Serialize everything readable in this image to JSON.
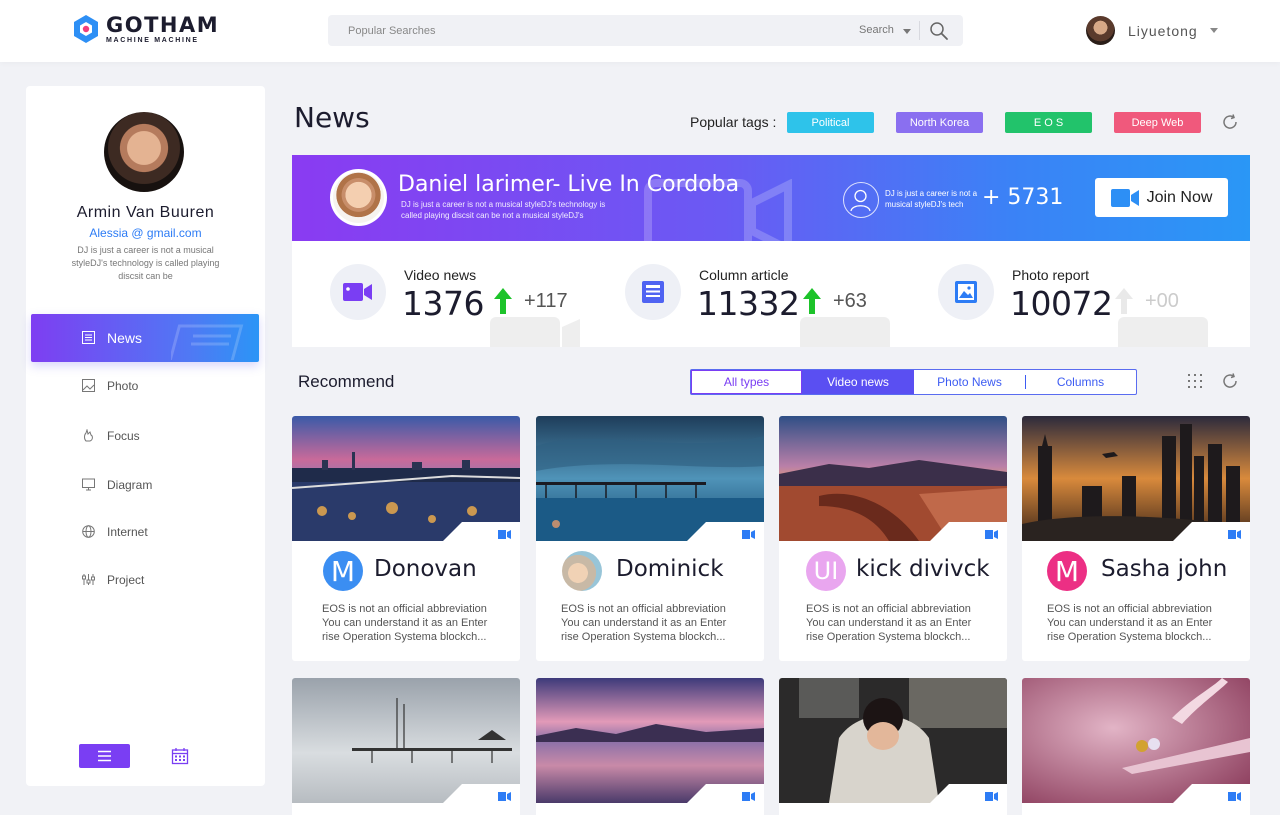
{
  "app": {
    "logo_title": "GOTHAM",
    "logo_sub": "MACHINE MACHINE",
    "brand_color": "#2d8ff5"
  },
  "search": {
    "placeholder": "Popular Searches",
    "scope": "Search"
  },
  "user": {
    "name": "Liyuetong"
  },
  "sidebar": {
    "profile_name": "Armin Van Buuren",
    "profile_email": "Alessia @ gmail.com",
    "profile_desc": "DJ is just a career is not a musical styleDJ's technology is called playing discsit can be",
    "items": [
      {
        "label": "News",
        "icon": "news-icon",
        "active": true
      },
      {
        "label": "Photo",
        "icon": "photo-icon"
      },
      {
        "label": "Focus",
        "icon": "focus-icon"
      },
      {
        "label": "Diagram",
        "icon": "diagram-icon"
      },
      {
        "label": "Internet",
        "icon": "globe-icon"
      },
      {
        "label": "Project",
        "icon": "project-icon"
      }
    ]
  },
  "page": {
    "title": "News",
    "tags_label": "Popular tags :",
    "tags": [
      {
        "label": "Political",
        "color": "#2ec3ea"
      },
      {
        "label": "North Korea",
        "color": "#8a6ff0"
      },
      {
        "label": "E O S",
        "color": "#22c36b"
      },
      {
        "label": "Deep Web",
        "color": "#f0597c"
      }
    ]
  },
  "banner": {
    "title": "Daniel larimer- Live In Cordoba",
    "desc": "DJ is just a career is not a musical styleDJ's technology is called playing discsit can be not a musical styleDJ's",
    "user_desc": "DJ is just a career is not a musical styleDJ's tech",
    "count": "+ 5731",
    "join_label": "Join Now"
  },
  "stats": [
    {
      "label": "Video news",
      "value": "1376",
      "delta": "+117",
      "up": true
    },
    {
      "label": "Column article",
      "value": "11332",
      "delta": "+63",
      "up": true
    },
    {
      "label": "Photo report",
      "value": "10072",
      "delta": "+00",
      "up": false
    }
  ],
  "recommend": {
    "title": "Recommend",
    "tabs": [
      "All types",
      "Video news",
      "Photo News",
      "Columns"
    ],
    "active_tab": "Video news"
  },
  "cards": [
    {
      "name": "Donovan",
      "avatar_letter": "M",
      "avatar_color": "#3b8ef2",
      "lines": [
        "EOS is not an official abbreviation",
        "You can understand it as an Enter",
        "rise Operation Systema blockch..."
      ]
    },
    {
      "name": "Dominick",
      "avatar_letter": "",
      "avatar_color": "#c8b9a6",
      "lines": [
        "EOS is not an official abbreviation",
        "You can understand it as an Enter",
        "rise Operation Systema blockch..."
      ]
    },
    {
      "name": "kick divivck",
      "avatar_letter": "UI",
      "avatar_color": "#e9a6ef",
      "lines": [
        "EOS is not an official abbreviation",
        "You can understand it as an Enter",
        "rise Operation Systema blockch..."
      ]
    },
    {
      "name": "Sasha john",
      "avatar_letter": "M",
      "avatar_color": "#ec2f84",
      "lines": [
        "EOS is not an official abbreviation",
        "You can understand it as an Enter",
        "rise Operation Systema blockch..."
      ]
    }
  ]
}
